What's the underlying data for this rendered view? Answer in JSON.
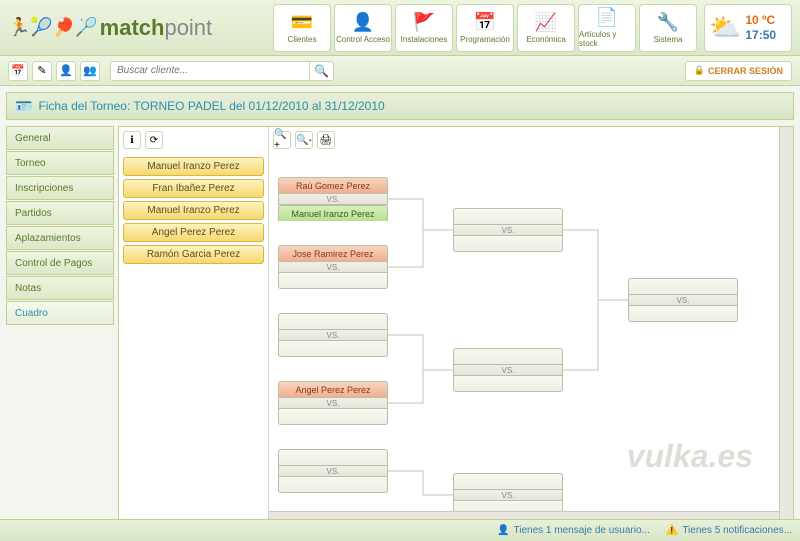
{
  "brand": {
    "match": "match",
    "point": "point"
  },
  "topnav": [
    {
      "icon": "💳",
      "label": "Clientes"
    },
    {
      "icon": "👤",
      "label": "Control Acceso"
    },
    {
      "icon": "🚩",
      "label": "Instalaciones"
    },
    {
      "icon": "📅",
      "label": "Programación"
    },
    {
      "icon": "📈",
      "label": "Económica"
    },
    {
      "icon": "📄",
      "label": "Artículos y stock"
    },
    {
      "icon": "🔧",
      "label": "Sistema"
    }
  ],
  "weather": {
    "temp": "10 ºC",
    "time": "17:50"
  },
  "search": {
    "placeholder": "Buscar cliente..."
  },
  "logout": "CERRAR SESIÓN",
  "titlebar": "Ficha del Torneo: TORNEO PADEL del 01/12/2010 al 31/12/2010",
  "sidebar": [
    "General",
    "Torneo",
    "Inscripciones",
    "Partidos",
    "Aplazamientos",
    "Control de Pagos",
    "Notas",
    "Cuadro"
  ],
  "sidebar_active": 7,
  "players": [
    "Manuel Iranzo Perez",
    "Fran Ibañez Perez",
    "Manuel Iranzo Perez",
    "Angel Perez Perez",
    "Ramón Garcia Perez"
  ],
  "vs": "VS.",
  "bracket": {
    "r1": [
      {
        "top": "Raú Gomez Perez",
        "top_cls": "slot-orange",
        "bot": "Manuel Iranzo Perez",
        "bot_cls": "slot-green"
      },
      {
        "top": "Jose Ramirez Perez",
        "top_cls": "slot-orange",
        "bot": "",
        "bot_cls": ""
      },
      {
        "top": "",
        "top_cls": "",
        "bot": "",
        "bot_cls": ""
      },
      {
        "top": "Angel Perez Perez",
        "top_cls": "slot-orange",
        "bot": "",
        "bot_cls": ""
      },
      {
        "top": "",
        "top_cls": "",
        "bot": "",
        "bot_cls": ""
      }
    ]
  },
  "footer": {
    "msg": "Tienes 1 mensaje de usuario...",
    "notif": "Tienes 5 notificaciones..."
  },
  "watermark": "vulka.es"
}
